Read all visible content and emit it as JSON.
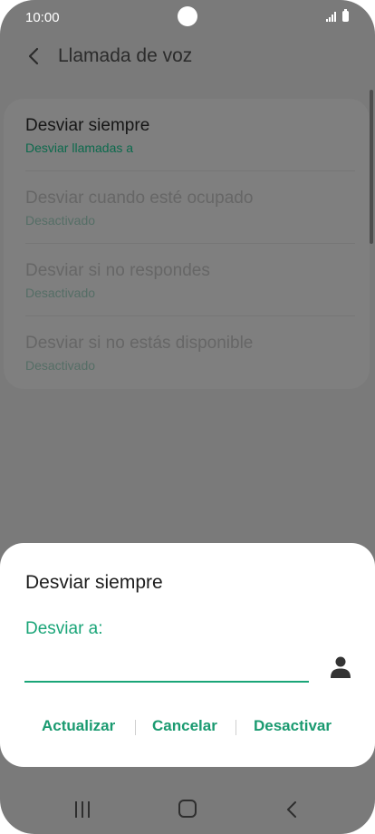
{
  "status_bar": {
    "time": "10:00"
  },
  "header": {
    "title": "Llamada de voz"
  },
  "settings": {
    "items": [
      {
        "label": "Desviar siempre",
        "sublabel": "Desviar llamadas a"
      },
      {
        "label": "Desviar cuando esté ocupado",
        "sublabel": "Desactivado"
      },
      {
        "label": "Desviar si no respondes",
        "sublabel": "Desactivado"
      },
      {
        "label": "Desviar si no estás disponible",
        "sublabel": "Desactivado"
      }
    ]
  },
  "dialog": {
    "title": "Desviar siempre",
    "field_label": "Desviar a:",
    "field_value": "",
    "buttons": {
      "update": "Actualizar",
      "cancel": "Cancelar",
      "deactivate": "Desactivar"
    }
  },
  "colors": {
    "accent": "#1aa578",
    "overlay": "#7a7a7a",
    "dialog_bg": "#ffffff"
  }
}
